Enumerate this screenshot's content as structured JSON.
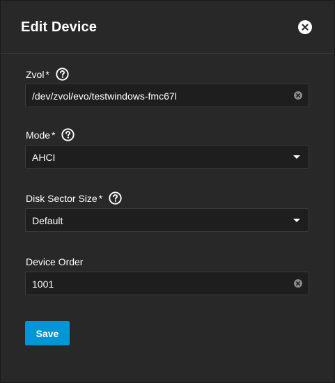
{
  "dialog": {
    "title": "Edit Device"
  },
  "fields": {
    "zvol": {
      "label": "Zvol",
      "required_marker": "*",
      "value": "/dev/zvol/evo/testwindows-fmc67l"
    },
    "mode": {
      "label": "Mode",
      "required_marker": "*",
      "value": "AHCI"
    },
    "sector_size": {
      "label": "Disk Sector Size",
      "required_marker": "*",
      "value": "Default"
    },
    "device_order": {
      "label": "Device Order",
      "value": "1001"
    }
  },
  "actions": {
    "save_label": "Save"
  },
  "icons": {
    "close": "close-icon",
    "help": "help-circle-icon",
    "clear": "clear-icon",
    "dropdown": "caret-down-icon"
  },
  "colors": {
    "background": "#282828",
    "input_background": "#1e1e1e",
    "accent": "#0095d5",
    "text": "#ffffff"
  }
}
